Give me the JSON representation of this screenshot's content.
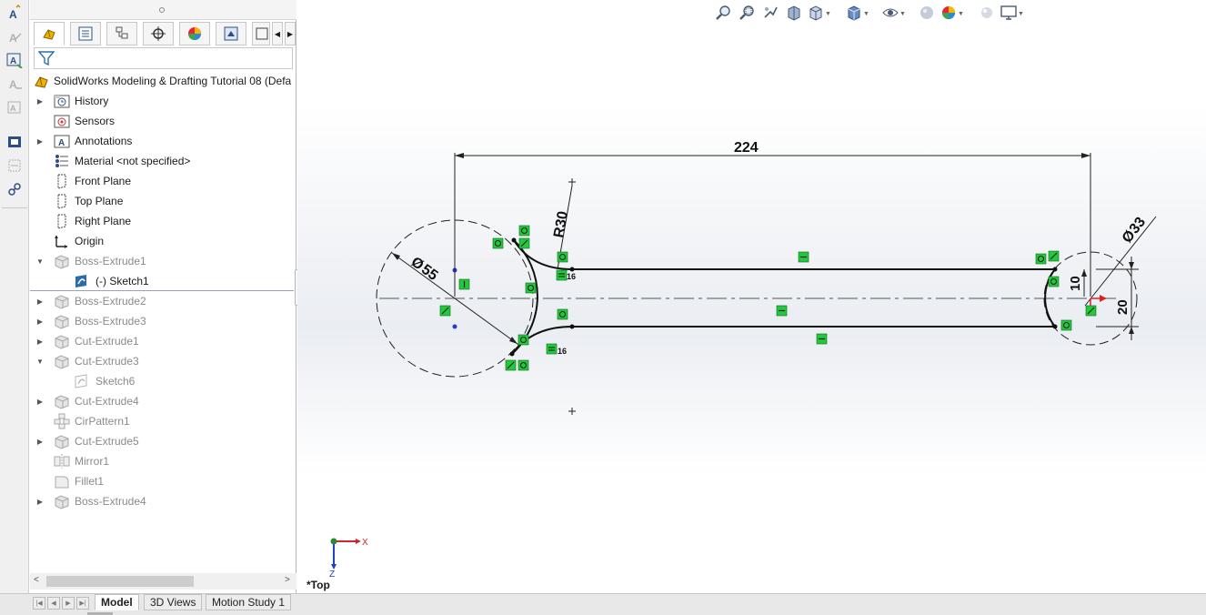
{
  "feature_tree": {
    "root": "SolidWorks Modeling & Drafting Tutorial 08  (Defa",
    "items": [
      {
        "label": "History",
        "expand": "right",
        "dim": false
      },
      {
        "label": "Sensors",
        "expand": "",
        "dim": false
      },
      {
        "label": "Annotations",
        "expand": "right",
        "dim": false
      },
      {
        "label": "Material <not specified>",
        "expand": "",
        "dim": false
      },
      {
        "label": "Front Plane",
        "expand": "",
        "dim": false
      },
      {
        "label": "Top Plane",
        "expand": "",
        "dim": false
      },
      {
        "label": "Right Plane",
        "expand": "",
        "dim": false
      },
      {
        "label": "Origin",
        "expand": "",
        "dim": false
      },
      {
        "label": "Boss-Extrude1",
        "expand": "down",
        "dim": true
      },
      {
        "label": "(-) Sketch1",
        "expand": "",
        "dim": false
      },
      {
        "label": "Boss-Extrude2",
        "expand": "right",
        "dim": true
      },
      {
        "label": "Boss-Extrude3",
        "expand": "right",
        "dim": true
      },
      {
        "label": "Cut-Extrude1",
        "expand": "right",
        "dim": true
      },
      {
        "label": "Cut-Extrude3",
        "expand": "down",
        "dim": true
      },
      {
        "label": "Sketch6",
        "expand": "",
        "dim": true
      },
      {
        "label": "Cut-Extrude4",
        "expand": "right",
        "dim": true
      },
      {
        "label": "CirPattern1",
        "expand": "",
        "dim": true
      },
      {
        "label": "Cut-Extrude5",
        "expand": "right",
        "dim": true
      },
      {
        "label": "Mirror1",
        "expand": "",
        "dim": true
      },
      {
        "label": "Fillet1",
        "expand": "",
        "dim": true
      },
      {
        "label": "Boss-Extrude4",
        "expand": "right",
        "dim": true
      }
    ]
  },
  "bottom_tabs": [
    "Model",
    "3D Views",
    "Motion Study 1"
  ],
  "active_bottom_tab": "Model",
  "view_orientation_label": "*Top",
  "triad": {
    "x_label": "X",
    "z_label": "Z"
  },
  "dimensions": {
    "overall_length": "224",
    "radius": "R30",
    "left_diameter": "55",
    "right_diameter": "33",
    "right_height_inner": "10",
    "right_height_outer": "20",
    "tangent_label_top": "16",
    "tangent_label_bottom": "16",
    "diameter_symbol": "Ø"
  },
  "colors": {
    "relation_green": "#22c93c",
    "sketch_black": "#101010",
    "origin_red": "#e02020",
    "point_blue": "#1f3cd6",
    "triad_x": "#d0262a",
    "triad_z": "#1f3fc4"
  },
  "heads_up_icons": [
    "zoom-to-fit-icon",
    "zoom-area-icon",
    "previous-view-icon",
    "section-view-icon",
    "view-orientation-icon",
    "display-style-icon",
    "hide-show-icon",
    "edit-appearance-icon",
    "apply-scene-icon",
    "view-settings-icon"
  ],
  "left_toolbar_icons": [
    "smart-dimension-icon",
    "note-icon",
    "balloon-icon",
    "auto-balloon-icon",
    "surface-finish-icon",
    "weld-symbol-icon",
    "datum-icon",
    "geometric-tolerance-icon"
  ]
}
